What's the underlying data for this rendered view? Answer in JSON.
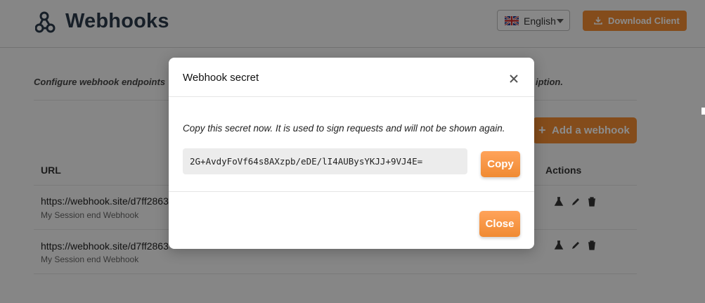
{
  "header": {
    "title": "Webhooks",
    "language": "English",
    "download_label": "Download Client"
  },
  "main": {
    "description_left": "Configure webhook endpoints",
    "description_right": "iption.",
    "add_button_label": "Add a webhook",
    "add_button_icon": "+",
    "columns": {
      "url": "URL",
      "actions": "Actions"
    },
    "rows": [
      {
        "url": "https://webhook.site/d7ff2863",
        "name": "My Session end Webhook"
      },
      {
        "url": "https://webhook.site/d7ff2863",
        "name": "My Session end Webhook"
      }
    ]
  },
  "modal": {
    "title": "Webhook secret",
    "close_icon": "×",
    "message": "Copy this secret now. It is used to sign requests and will not be shown again.",
    "secret_value": "2G+AvdyFoVf64s8AXzpb/eDE/lI4AUBysYKJJ+9VJ4E=",
    "copy_label": "Copy",
    "close_label": "Close"
  },
  "colors": {
    "accent": "#f08a32",
    "title": "#2b3a4a",
    "overlay": "rgba(0,0,0,0.45)"
  }
}
